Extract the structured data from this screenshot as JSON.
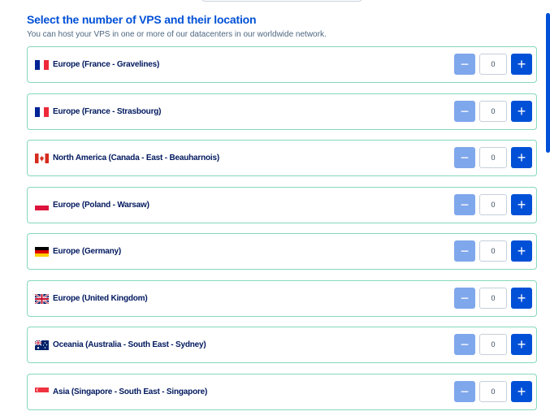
{
  "header": {
    "title": "Select the number of VPS and their location",
    "subtitle": "You can host your VPS in one or more of our datacenters in our worldwide network."
  },
  "colors": {
    "accent": "#0050d7",
    "accent_light": "#7fa7eb",
    "row_border": "#85d9ba",
    "label_text": "#00185e"
  },
  "stepper": {
    "minus_symbol": "−",
    "plus_symbol": "+"
  },
  "locations": [
    {
      "label": "Europe (France - Gravelines)",
      "flag": "france-flag",
      "quantity": "0"
    },
    {
      "label": "Europe (France - Strasbourg)",
      "flag": "france-flag",
      "quantity": "0"
    },
    {
      "label": "North America (Canada - East - Beauharnois)",
      "flag": "canada-flag",
      "quantity": "0"
    },
    {
      "label": "Europe (Poland - Warsaw)",
      "flag": "poland-flag",
      "quantity": "0"
    },
    {
      "label": "Europe (Germany)",
      "flag": "germany-flag",
      "quantity": "0"
    },
    {
      "label": "Europe (United Kingdom)",
      "flag": "uk-flag",
      "quantity": "0"
    },
    {
      "label": "Oceania (Australia - South East - Sydney)",
      "flag": "australia-flag",
      "quantity": "0"
    },
    {
      "label": "Asia (Singapore - South East - Singapore)",
      "flag": "singapore-flag",
      "quantity": "0"
    }
  ]
}
